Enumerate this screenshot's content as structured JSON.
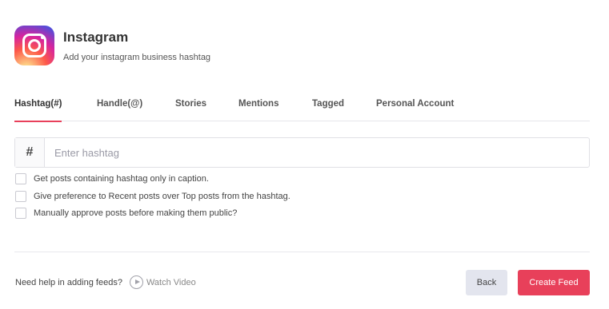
{
  "header": {
    "icon": "instagram-logo-icon",
    "title": "Instagram",
    "subtitle": "Add your instagram business hashtag"
  },
  "tabs": [
    {
      "label": "Hashtag(#)",
      "active": true
    },
    {
      "label": "Handle(@)",
      "active": false
    },
    {
      "label": "Stories",
      "active": false
    },
    {
      "label": "Mentions",
      "active": false
    },
    {
      "label": "Tagged",
      "active": false
    },
    {
      "label": "Personal Account",
      "active": false
    }
  ],
  "hashtag": {
    "prefix": "#",
    "placeholder": "Enter hashtag",
    "value": ""
  },
  "options": [
    {
      "label": "Get posts containing hashtag only in caption.",
      "checked": false
    },
    {
      "label": "Give preference to Recent posts over Top posts from the hashtag.",
      "checked": false
    },
    {
      "label": "Manually approve posts before making them public?",
      "checked": false
    }
  ],
  "footer": {
    "help_text": "Need help in adding feeds?",
    "watch_video_label": "Watch Video",
    "back_label": "Back",
    "create_label": "Create Feed"
  },
  "colors": {
    "accent": "#e8405a",
    "back_button_bg": "#e3e5ee"
  }
}
